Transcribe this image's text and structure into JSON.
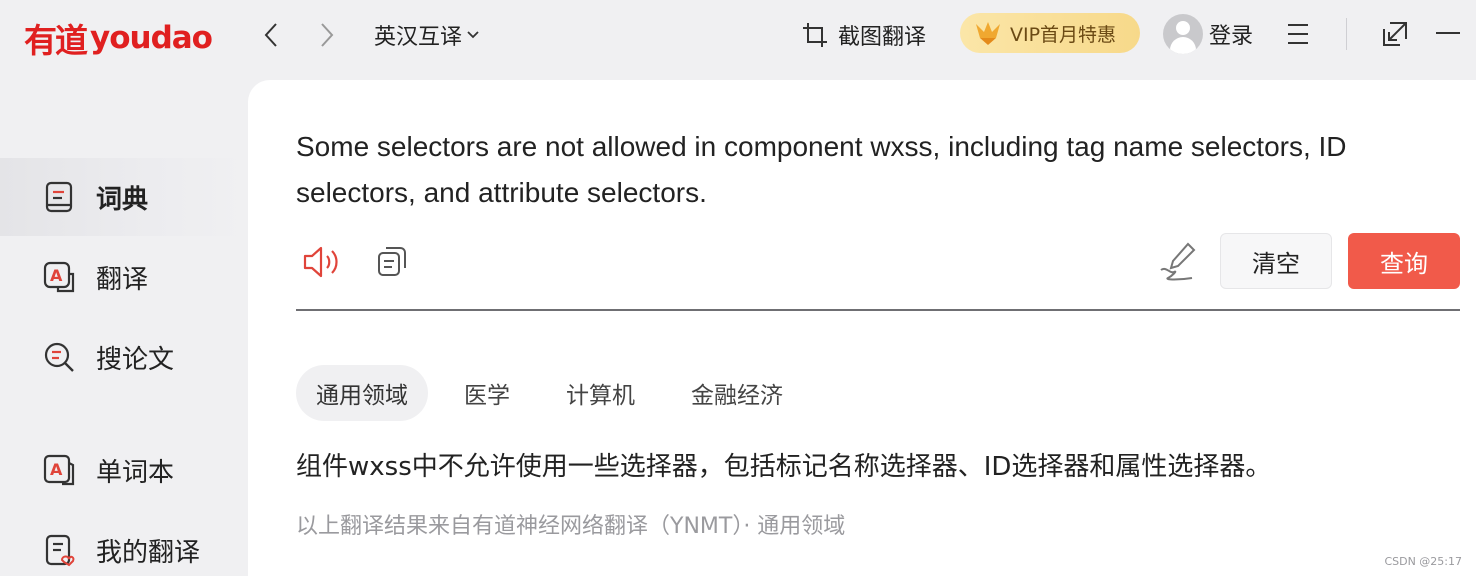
{
  "app": {
    "logo_cn": "有道",
    "logo_en": "youdao"
  },
  "header": {
    "lang_label": "英汉互译",
    "screenshot_label": "截图翻译",
    "vip_label": "VIP首月特惠",
    "login_label": "登录"
  },
  "sidebar": {
    "items": [
      {
        "label": "词典",
        "icon": "dictionary-icon"
      },
      {
        "label": "翻译",
        "icon": "translate-icon"
      },
      {
        "label": "搜论文",
        "icon": "search-paper-icon"
      },
      {
        "label": "单词本",
        "icon": "wordbook-icon"
      },
      {
        "label": "我的翻译",
        "icon": "my-translation-icon"
      }
    ]
  },
  "main": {
    "source_text": "Some selectors are not allowed in component wxss, including tag name selectors, ID selectors, and attribute selectors.",
    "clear_label": "清空",
    "query_label": "查询",
    "tabs": [
      "通用领域",
      "医学",
      "计算机",
      "金融经济"
    ],
    "result_text": "组件wxss中不允许使用一些选择器，包括标记名称选择器、ID选择器和属性选择器。",
    "source_note": "以上翻译结果来自有道神经网络翻译（YNMT）· 通用领域"
  },
  "watermark": "CSDN @25:17",
  "colors": {
    "brand_red": "#e02020",
    "query_button": "#f15a4a",
    "vip_gold": "#f7d98a"
  }
}
